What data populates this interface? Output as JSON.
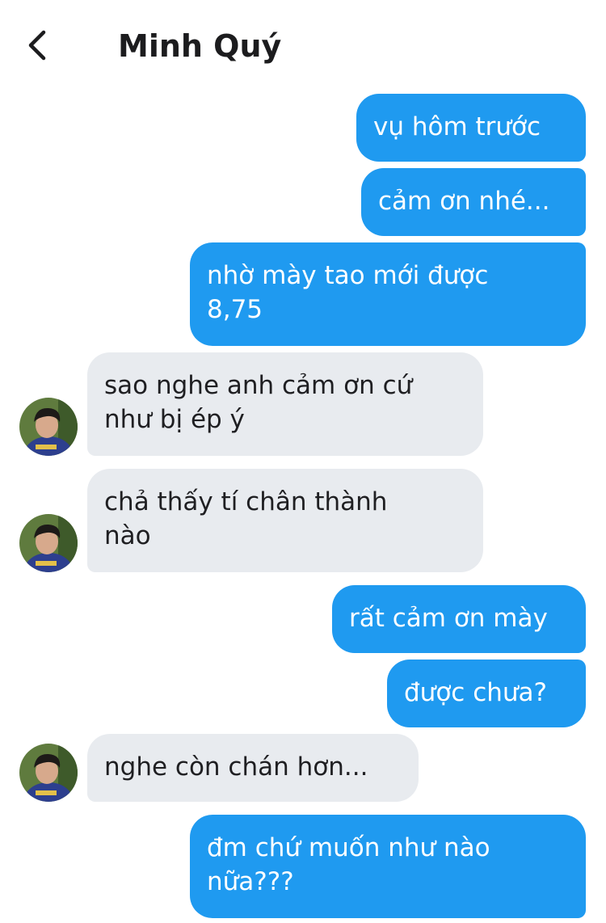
{
  "header": {
    "contact_name": "Minh Quý",
    "back_icon": "chevron-left-icon"
  },
  "colors": {
    "outgoing_bubble": "#1f9af0",
    "incoming_bubble": "#e8ebef",
    "outgoing_text": "#ffffff",
    "incoming_text": "#1f1f22"
  },
  "messages": [
    {
      "direction": "outgoing",
      "lines": [
        "vụ hôm trước"
      ]
    },
    {
      "direction": "outgoing",
      "lines": [
        "cảm ơn nhé..."
      ]
    },
    {
      "direction": "outgoing",
      "lines": [
        "nhờ mày tao mới được",
        "8,75"
      ]
    },
    {
      "direction": "incoming",
      "lines": [
        "sao nghe anh cảm ơn cứ",
        "như bị ép ý"
      ]
    },
    {
      "direction": "incoming",
      "lines": [
        "chả thấy tí chân thành",
        "nào"
      ]
    },
    {
      "direction": "outgoing",
      "lines": [
        "rất cảm ơn mày"
      ]
    },
    {
      "direction": "outgoing",
      "lines": [
        "được chưa?"
      ]
    },
    {
      "direction": "incoming",
      "lines": [
        "nghe còn chán hơn..."
      ]
    },
    {
      "direction": "outgoing",
      "lines": [
        "đm chứ muốn như nào",
        "nữa???"
      ]
    }
  ]
}
